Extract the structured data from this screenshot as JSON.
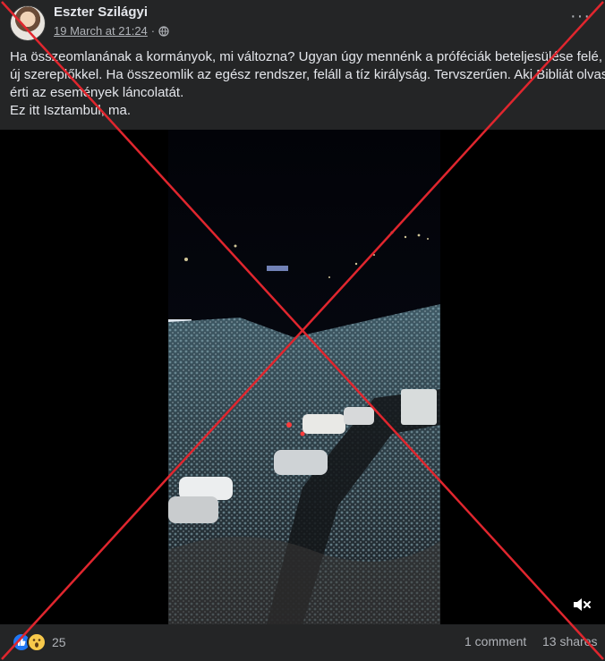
{
  "post": {
    "author": "Eszter Szilágyi",
    "timestamp": "19 March at 21:24",
    "separator": "·",
    "more": "···",
    "text_lines": [
      "Ha összeomlanának a kormányok, mi változna? Ugyan úgy mennénk a próféciák beteljesülése felé,",
      "új szereplőkkel. Ha összeomlik az egész rendszer, feláll a tíz királyság. Tervszerűen. Aki Bibliát olvas,",
      "érti az események láncolatát.",
      "Ez itt Isztambul, ma."
    ]
  },
  "footer": {
    "reaction_count": "25",
    "comments": "1 comment",
    "shares": "13 shares"
  },
  "icons": {
    "globe": "globe-icon",
    "mute": "speaker-muted-icon",
    "like": "thumbs-up-icon",
    "wow": "wow-face-icon"
  },
  "colors": {
    "background": "#242526",
    "cross": "#e0262e",
    "like": "#2078f4",
    "wow": "#f7c94b"
  }
}
